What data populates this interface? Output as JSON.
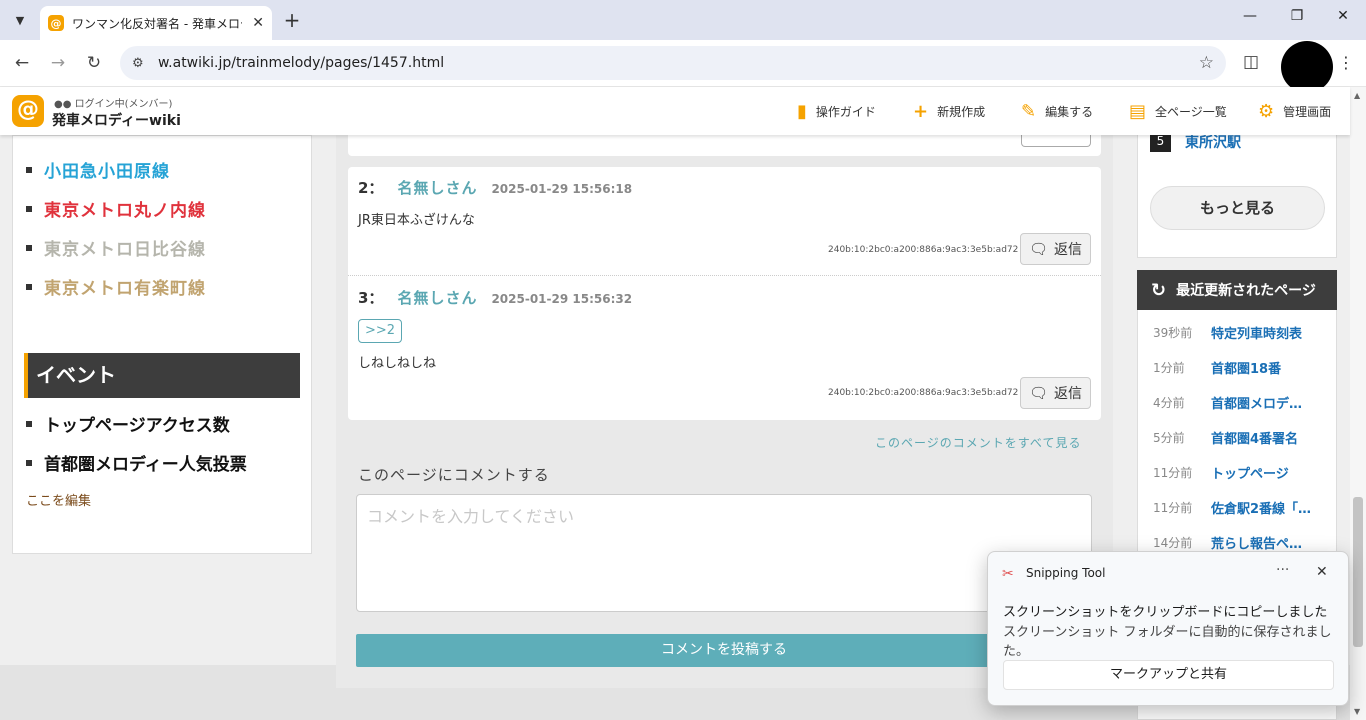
{
  "browser": {
    "tab_title": "ワンマン化反対署名 - 発車メロディ",
    "favicon_letter": "@",
    "url": "w.atwiki.jp/trainmelody/pages/1457.html"
  },
  "header": {
    "login_status": "ログイン中(メンバー)",
    "wiki_name": "発車メロディーwiki",
    "nav": [
      {
        "label": "操作ガイド"
      },
      {
        "label": "新規作成"
      },
      {
        "label": "編集する"
      },
      {
        "label": "全ページ一覧"
      },
      {
        "label": "管理画面"
      }
    ]
  },
  "sidebar": {
    "lines": [
      {
        "label": "小田急小田原線",
        "color": "#26a3d6"
      },
      {
        "label": "東京メトロ丸ノ内線",
        "color": "#e0323c"
      },
      {
        "label": "東京メトロ日比谷線",
        "color": "#b5b5ac"
      },
      {
        "label": "東京メトロ有楽町線",
        "color": "#c1a470"
      }
    ],
    "event_heading": "イベント",
    "events": [
      {
        "label": "トップページアクセス数"
      },
      {
        "label": "首都圏メロディー人気投票"
      }
    ],
    "edit_link": "ここを編集"
  },
  "comments": [
    {
      "num": "2：",
      "name": "名無しさん",
      "date": "2025-01-29 15:56:18",
      "anchor": "",
      "body": "JR東日本ふざけんな",
      "ip": "240b:10:2bc0:a200:886a:9ac3:3e5b:ad72",
      "reply_label": "返信"
    },
    {
      "num": "3：",
      "name": "名無しさん",
      "date": "2025-01-29 15:56:32",
      "anchor": ">>2",
      "body": "しねしねしね",
      "ip": "240b:10:2bc0:a200:886a:9ac3:3e5b:ad72",
      "reply_label": "返信"
    }
  ],
  "comment_form": {
    "see_all": "このページのコメントをすべて見る",
    "label": "このページにコメントする",
    "placeholder": "コメントを入力してください",
    "submit": "コメントを投稿する"
  },
  "right": {
    "rank_item": {
      "rank": "5",
      "label": "東所沢駅"
    },
    "more": "もっと見る",
    "recent_heading": "最近更新されたページ",
    "recent": [
      {
        "ago": "39秒前",
        "page": "特定列車時刻表"
      },
      {
        "ago": "1分前",
        "page": "首都圏18番"
      },
      {
        "ago": "4分前",
        "page": "首都圏メロデ…"
      },
      {
        "ago": "5分前",
        "page": "首都圏4番署名"
      },
      {
        "ago": "11分前",
        "page": "トップページ"
      },
      {
        "ago": "11分前",
        "page": "佐倉駅2番線「…"
      },
      {
        "ago": "14分前",
        "page": "荒らし報告ペ…"
      }
    ]
  },
  "toast": {
    "app": "Snipping Tool",
    "dots": "···",
    "line1": "スクリーンショットをクリップボードにコピーしました",
    "line2": "スクリーンショット フォルダーに自動的に保存されました。",
    "action": "マークアップと共有"
  },
  "colors": {
    "accent": "#f5a200",
    "teal": "#5eaeb9",
    "link": "#1a6fb5"
  }
}
